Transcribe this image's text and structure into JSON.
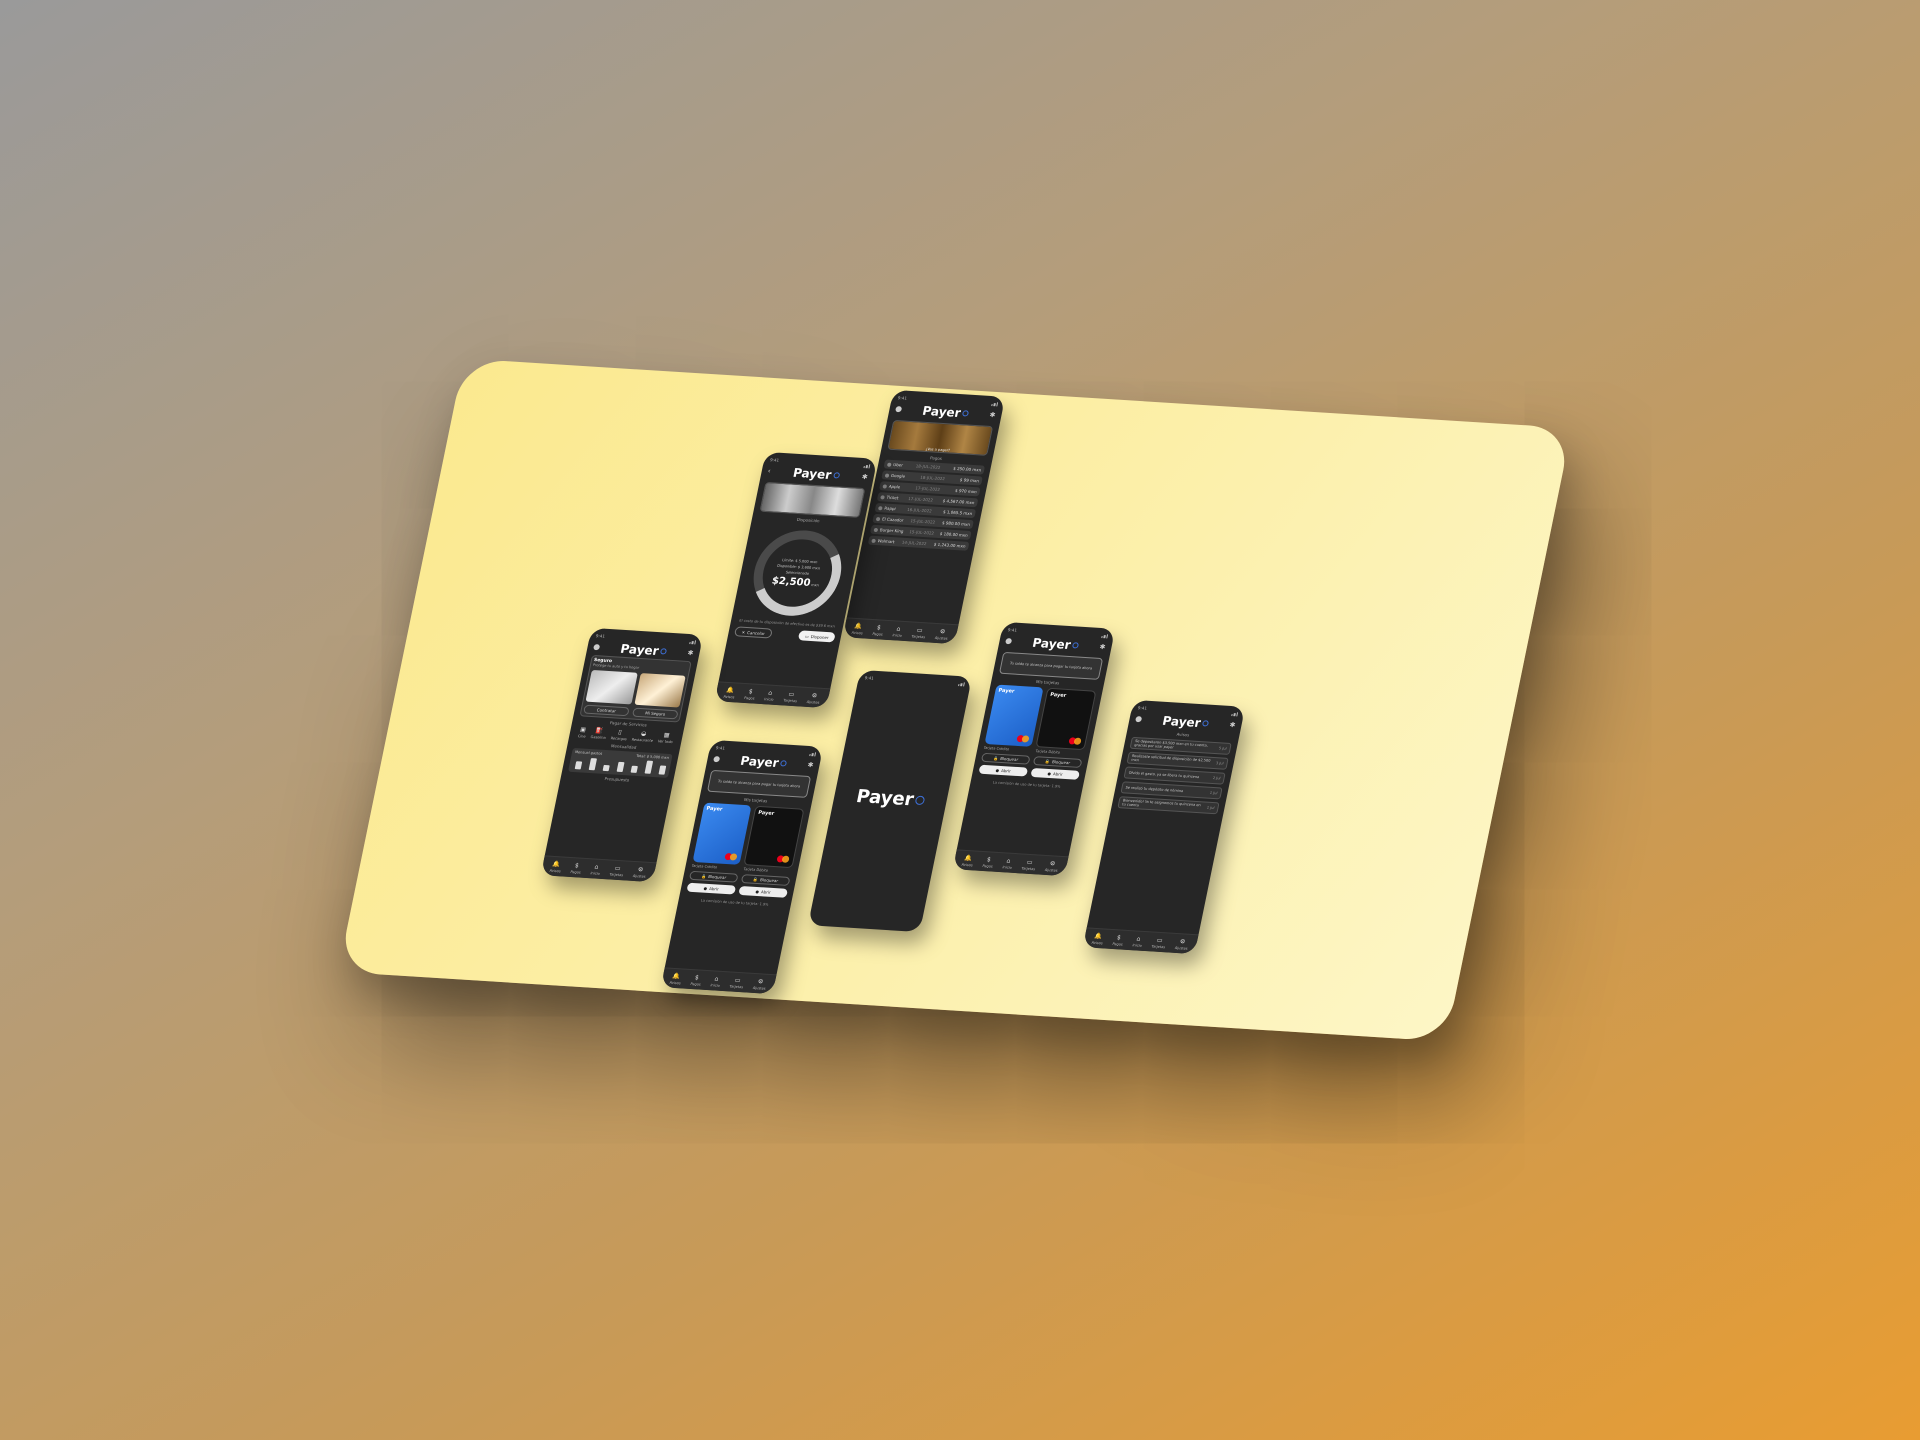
{
  "app": {
    "name": "Payer"
  },
  "time": "9:41",
  "nav": [
    {
      "label": "Avisos",
      "icon": "bell-icon"
    },
    {
      "label": "Pagos",
      "icon": "dollar-icon"
    },
    {
      "label": "Inicio",
      "icon": "home-icon"
    },
    {
      "label": "Tarjetas",
      "icon": "card-icon"
    },
    {
      "label": "Ajustes",
      "icon": "settings-icon"
    }
  ],
  "payments_screen": {
    "banner_caption": "¿Vas a pagar?",
    "section": "Pagos",
    "rows": [
      {
        "name": "Uber",
        "date": "18-JUL-2022",
        "amount": "$ 250.00 mxn"
      },
      {
        "name": "Google",
        "date": "18-JUL-2022",
        "amount": "$ 99 mxn"
      },
      {
        "name": "Apple",
        "date": "17-JUL-2022",
        "amount": "$ 970 mxn"
      },
      {
        "name": "Ticket",
        "date": "17-JUL-2022",
        "amount": "$ 4,567.00 mxn"
      },
      {
        "name": "Rappi",
        "date": "16-JUL-2022",
        "amount": "$ 1,065.5 mxn"
      },
      {
        "name": "El Cazador",
        "date": "15-JUL-2022",
        "amount": "$ 980.00 mxn"
      },
      {
        "name": "Burger King",
        "date": "15-JUL-2022",
        "amount": "$ 180.00 mxn"
      },
      {
        "name": "Walmart",
        "date": "14-JUL-2022",
        "amount": "$ 1,243.00 mxn"
      }
    ]
  },
  "dispose_screen": {
    "section": "Disposición",
    "limit": "Límite: $ 5,000 mxn",
    "available": "Disponible: $ 3,600 mxn",
    "select_label": "Seleccionado",
    "amount": "$2,500",
    "currency": "mxn",
    "note": "El costo de tu disposición de efectivo es de $39.6 mxn",
    "cancel": "Cancelar",
    "confirm": "Disponer"
  },
  "cards_screen": {
    "tip": "Tu saldo te alcanza para pagar tu tarjeta ahora",
    "section": "Mis tarjetas",
    "card_blue_label": "Payer",
    "card_black_label": "Payer",
    "cap_left": "Tarjeta Crédito",
    "cap_right": "Tarjeta Débito",
    "block": "Bloquear",
    "action": "Abrir",
    "footer": "La comisión de uso de tu tarjeta: 1.9%"
  },
  "home_screen": {
    "section_title": "Seguro",
    "section_sub": "Protege tu auto y tu hogar",
    "btn_left": "Contratar",
    "btn_right": "Mi Seguro",
    "services_title": "Pagar de Servicios",
    "services": [
      {
        "label": "Cine",
        "icon": "film-icon"
      },
      {
        "label": "Gasolina",
        "icon": "fuel-icon"
      },
      {
        "label": "Recargas",
        "icon": "phone-icon"
      },
      {
        "label": "Restaurante",
        "icon": "food-icon"
      },
      {
        "label": "Ver todo",
        "icon": "grid-icon"
      }
    ],
    "monthly": "Mensualidad",
    "expenses_label": "Mensual gastos",
    "total": "Total: $ 5,000 mxn",
    "footer": "Presupuesto"
  },
  "alerts_screen": {
    "section": "Avisos",
    "items": [
      {
        "text": "Se depositaron $3,500 mxn en tu cuenta, gracias por usar payer",
        "age": "5 Jul"
      },
      {
        "text": "Realizaste solicitud de disposición de $2,500 mxn",
        "age": "3 Jul"
      },
      {
        "text": "Olvida el gasto, ya se libera tu quincena",
        "age": "2 Jul"
      },
      {
        "text": "Se realizó tu depósito de nómina",
        "age": "1 Jul"
      },
      {
        "text": "Bienvenido! Ya te asignamos tu quincena en tu cuenta",
        "age": "1 Jul"
      }
    ]
  }
}
